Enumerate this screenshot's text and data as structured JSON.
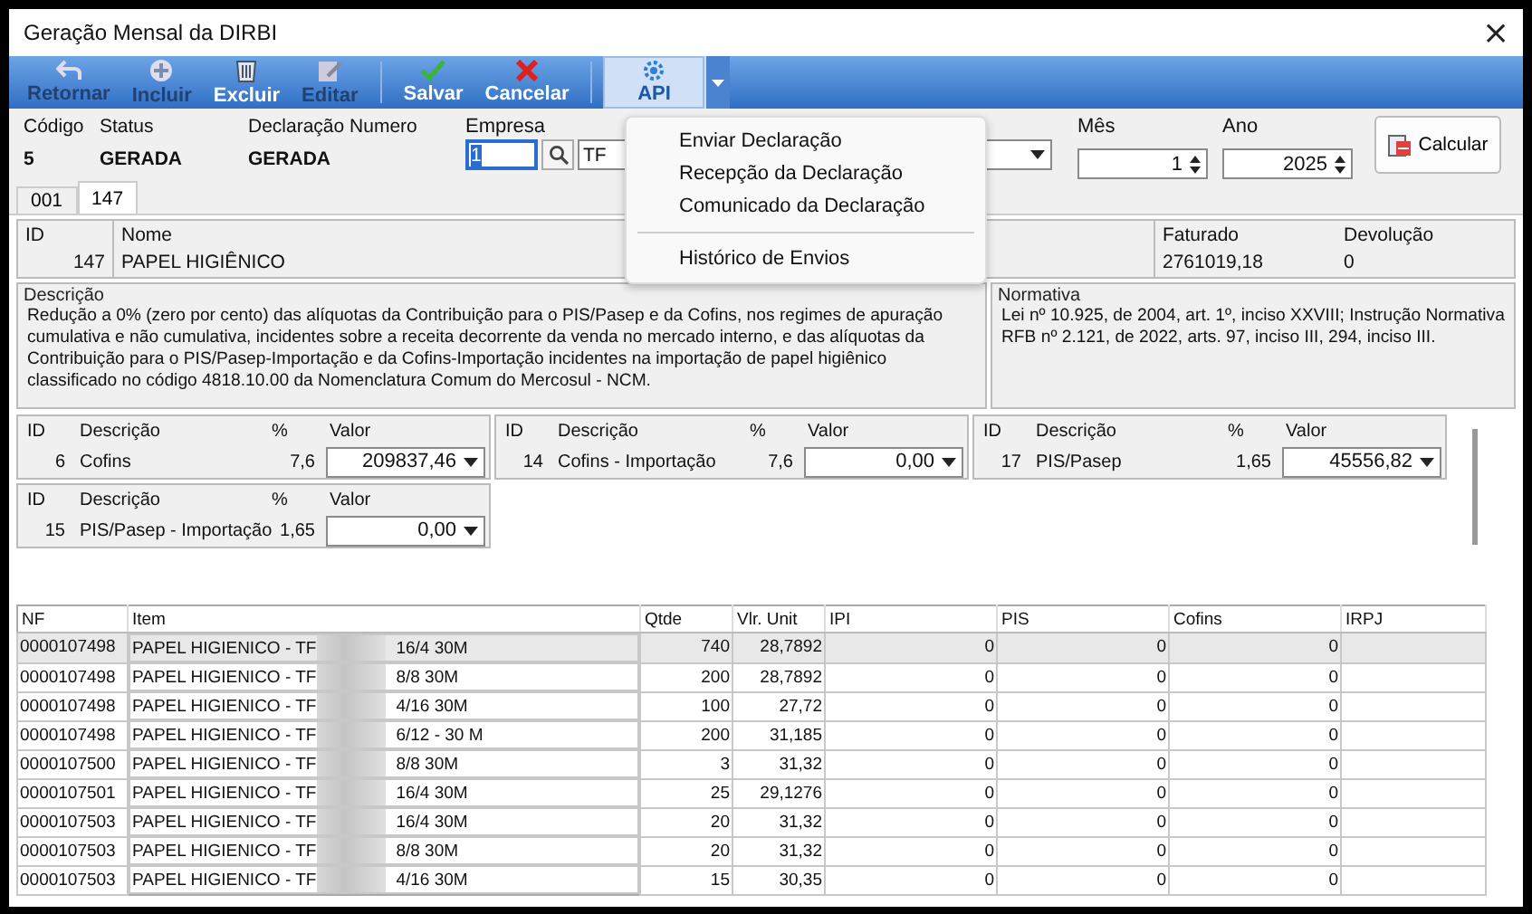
{
  "window": {
    "title": "Geração Mensal da DIRBI",
    "close": "×"
  },
  "toolbar": [
    {
      "kind": "back",
      "label": "Retornar",
      "disabled": true,
      "selected": false
    },
    {
      "kind": "add",
      "label": "Incluir",
      "disabled": true,
      "selected": false
    },
    {
      "kind": "delete",
      "label": "Excluir",
      "disabled": false,
      "selected": false
    },
    {
      "kind": "edit",
      "label": "Editar",
      "disabled": true,
      "selected": false
    },
    {
      "kind": "save",
      "label": "Salvar",
      "disabled": false,
      "selected": false
    },
    {
      "kind": "cancel",
      "label": "Cancelar",
      "disabled": false,
      "selected": false
    },
    {
      "kind": "api",
      "label": "API",
      "disabled": false,
      "selected": true
    }
  ],
  "header": {
    "codigo": {
      "label": "Código",
      "value": "5"
    },
    "status": {
      "label": "Status",
      "value": "GERADA"
    },
    "declaracao": {
      "label": "Declaração Numero",
      "value": "GERADA"
    },
    "empresa": {
      "label": "Empresa",
      "value": "1",
      "name": "TF"
    },
    "mes": {
      "label": "Mês",
      "value": "1"
    },
    "ano": {
      "label": "Ano",
      "value": "2025"
    },
    "calcular": "Calcular"
  },
  "menu": [
    {
      "kind": "item",
      "label": "Enviar Declaração"
    },
    {
      "kind": "item",
      "label": "Recepção da Declaração"
    },
    {
      "kind": "item",
      "label": "Comunicado da Declaração"
    },
    {
      "kind": "separator"
    },
    {
      "kind": "item",
      "label": "Histórico de Envios"
    }
  ],
  "tabs": [
    {
      "label": "001",
      "selected": false
    },
    {
      "label": "147",
      "selected": true
    }
  ],
  "product": {
    "id": {
      "label": "ID",
      "value": "147"
    },
    "nome": {
      "label": "Nome",
      "value": "PAPEL HIGIÊNICO"
    },
    "faturado": {
      "label": "Faturado",
      "value": "2761019,18"
    },
    "devolucao": {
      "label": "Devolução",
      "value": "0"
    }
  },
  "descricao": {
    "label": "Descrição",
    "text": "Redução a 0% (zero por cento) das alíquotas da Contribuição para o PIS/Pasep e da Cofins, nos regimes de apuração cumulativa e não cumulativa, incidentes sobre a receita decorrente da venda no mercado interno, e das alíquotas da Contribuição para o PIS/Pasep-Importação e da Cofins-Importação incidentes na importação de papel higiênico classificado no código 4818.10.00 da Nomenclatura Comum do Mercosul - NCM."
  },
  "normativa": {
    "label": "Normativa",
    "text": "Lei nº 10.925, de 2004, art. 1º, inciso XXVIII; Instrução Normativa RFB nº 2.121, de 2022, arts. 97, inciso III, 294, inciso III."
  },
  "taxes": [
    {
      "headers": [
        "ID",
        "Descrição",
        "%",
        "Valor"
      ],
      "id": "6",
      "descricao": "Cofins",
      "percent": "7,6",
      "valor": "209837,46"
    },
    {
      "headers": [
        "ID",
        "Descrição",
        "%",
        "Valor"
      ],
      "id": "14",
      "descricao": "Cofins - Importação",
      "percent": "7,6",
      "valor": "0,00"
    },
    {
      "headers": [
        "ID",
        "Descrição",
        "%",
        "Valor"
      ],
      "id": "17",
      "descricao": "PIS/Pasep",
      "percent": "1,65",
      "valor": "45556,82"
    },
    {
      "headers": [
        "ID",
        "Descrição",
        "%",
        "Valor"
      ],
      "id": "15",
      "descricao": "PIS/Pasep - Importação",
      "percent": "1,65",
      "valor": "0,00"
    }
  ],
  "table": {
    "columns": [
      "NF",
      "Item",
      "Qtde",
      "Vlr. Unit",
      "IPI",
      "PIS",
      "Cofins",
      "IRPJ"
    ],
    "rows": [
      {
        "selected": true,
        "nf": "0000107498",
        "item": "PAPEL HIGIENICO - TF",
        "item_end": "16/4 30M",
        "qtde": "740",
        "vlr_unit": "28,7892",
        "ipi": "0",
        "pis": "0",
        "cofins": "0"
      },
      {
        "selected": false,
        "nf": "0000107498",
        "item": "PAPEL HIGIENICO - TF",
        "item_end": "8/8 30M",
        "qtde": "200",
        "vlr_unit": "28,7892",
        "ipi": "0",
        "pis": "0",
        "cofins": "0"
      },
      {
        "selected": false,
        "nf": "0000107498",
        "item": "PAPEL HIGIENICO - TF",
        "item_end": "4/16 30M",
        "qtde": "100",
        "vlr_unit": "27,72",
        "ipi": "0",
        "pis": "0",
        "cofins": "0"
      },
      {
        "selected": false,
        "nf": "0000107498",
        "item": "PAPEL HIGIENICO - TF",
        "item_end": "6/12 - 30 M",
        "qtde": "200",
        "vlr_unit": "31,185",
        "ipi": "0",
        "pis": "0",
        "cofins": "0"
      },
      {
        "selected": false,
        "nf": "0000107500",
        "item": "PAPEL HIGIENICO - TF",
        "item_end": "8/8 30M",
        "qtde": "3",
        "vlr_unit": "31,32",
        "ipi": "0",
        "pis": "0",
        "cofins": "0"
      },
      {
        "selected": false,
        "nf": "0000107501",
        "item": "PAPEL HIGIENICO - TF",
        "item_end": "16/4 30M",
        "qtde": "25",
        "vlr_unit": "29,1276",
        "ipi": "0",
        "pis": "0",
        "cofins": "0"
      },
      {
        "selected": false,
        "nf": "0000107503",
        "item": "PAPEL HIGIENICO - TF",
        "item_end": "16/4 30M",
        "qtde": "20",
        "vlr_unit": "31,32",
        "ipi": "0",
        "pis": "0",
        "cofins": "0"
      },
      {
        "selected": false,
        "nf": "0000107503",
        "item": "PAPEL HIGIENICO - TF",
        "item_end": "8/8 30M",
        "qtde": "20",
        "vlr_unit": "31,32",
        "ipi": "0",
        "pis": "0",
        "cofins": "0"
      },
      {
        "selected": false,
        "nf": "0000107503",
        "item": "PAPEL HIGIENICO - TF",
        "item_end": "4/16 30M",
        "qtde": "15",
        "vlr_unit": "30,35",
        "ipi": "0",
        "pis": "0",
        "cofins": "0"
      }
    ]
  }
}
